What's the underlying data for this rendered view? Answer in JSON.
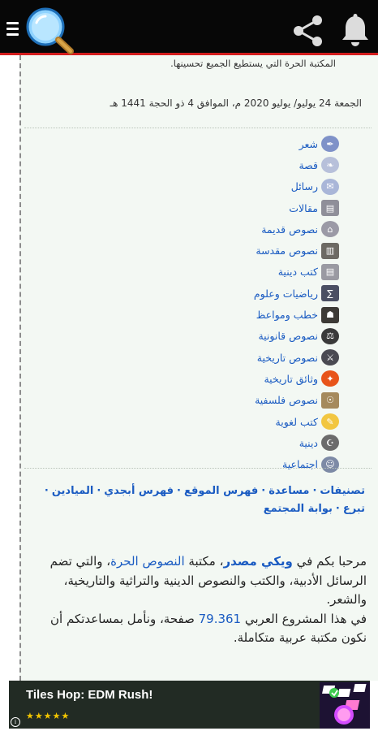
{
  "header": {
    "menu_icon": "menu-icon",
    "search_icon": "search-icon",
    "share_icon": "share-icon",
    "notification_icon": "bell-icon",
    "bar_color": "#070707",
    "accent_color": "#d31d1d"
  },
  "intro": {
    "text": "المكتبة الحرة التي يستطيع الجميع تحسينها."
  },
  "date_line": "الجمعة 24 يوليو/ يوليو 2020 م، الموافق 4 ذو الحجة 1441 هـ",
  "categories": [
    {
      "label": "شعر",
      "icon": "quill-icon"
    },
    {
      "label": "قصة",
      "icon": "book-icon"
    },
    {
      "label": "رسائل",
      "icon": "letter-icon"
    },
    {
      "label": "مقالات",
      "icon": "article-icon"
    },
    {
      "label": "نصوص قديمة",
      "icon": "ancient-icon"
    },
    {
      "label": "نصوص مقدسة",
      "icon": "holy-icon"
    },
    {
      "label": "كتب دينية",
      "icon": "religious-book-icon"
    },
    {
      "label": "رياضيات وعلوم",
      "icon": "science-icon"
    },
    {
      "label": "خطب ومواعظ",
      "icon": "speech-icon"
    },
    {
      "label": "نصوص قانونية",
      "icon": "law-icon"
    },
    {
      "label": "نصوص تاريخية",
      "icon": "history-icon"
    },
    {
      "label": "وثائق تاريخية",
      "icon": "document-icon"
    },
    {
      "label": "نصوص فلسفية",
      "icon": "philosophy-icon"
    },
    {
      "label": "كتب لغوية",
      "icon": "language-icon"
    },
    {
      "label": "دينية",
      "icon": "mosque-icon"
    },
    {
      "label": "اجتماعية",
      "icon": "people-icon"
    }
  ],
  "nav_links": {
    "categories": "تصنيفات",
    "help": "مساعدة",
    "site_index": "فهرس الموقع",
    "abjad_index": "فهرس أبجدي",
    "fields": "الميادين",
    "donate": "تبرع",
    "community_portal": "بوابة المجتمع",
    "separator": "·"
  },
  "welcome": {
    "p1_a": "مرحبا بكم في ",
    "wiki_source": "ويكي مصدر",
    "p1_b": "، مكتبة ",
    "free_texts": "النصوص الحرة",
    "p1_c": "، والتي تضم الرسائل الأدبية، والكتب والنصوص الدينية والتراثية والتاريخية، والشعر.",
    "p2_a": "في هذا المشروع العربي ",
    "page_count": "79.361",
    "p2_b": " صفحة، ونأمل بمساعدتكم أن نكون مكتبة عربية متكاملة."
  },
  "ad": {
    "title": "Tiles Hop: EDM Rush!",
    "stars": "★★★★★",
    "info_icon": "info-icon",
    "game_icon": "game-icon"
  }
}
